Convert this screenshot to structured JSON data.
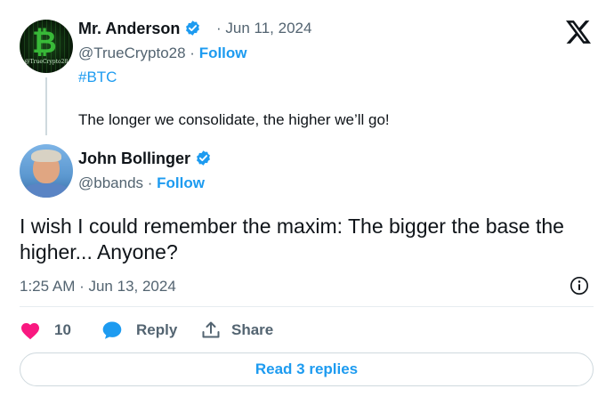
{
  "parent_tweet": {
    "avatar_caption": "@TrueCrypto28",
    "display_name": "Mr. Anderson",
    "date": "· Jun 11, 2024",
    "handle": "@TrueCrypto28 ·",
    "follow_label": "Follow",
    "hashtag": "#BTC",
    "text": "The longer we consolidate, the higher we’ll go!"
  },
  "reply_tweet": {
    "display_name": "John Bollinger",
    "handle": "@bbands ·",
    "follow_label": "Follow",
    "text": "I wish I could remember the maxim: The bigger the base the higher... Anyone?",
    "timestamp": "1:25 AM · Jun 13, 2024",
    "like_count": "10",
    "reply_label": "Reply",
    "share_label": "Share",
    "read_replies_label": "Read 3 replies"
  },
  "colors": {
    "accent": "#1d9bf0",
    "like": "#f91880",
    "muted": "#536471"
  },
  "icons": {
    "verified": "verified-badge-icon",
    "brand": "x-logo-icon",
    "info": "info-icon",
    "like": "heart-icon",
    "reply": "chat-bubble-icon",
    "share": "share-upload-icon"
  }
}
